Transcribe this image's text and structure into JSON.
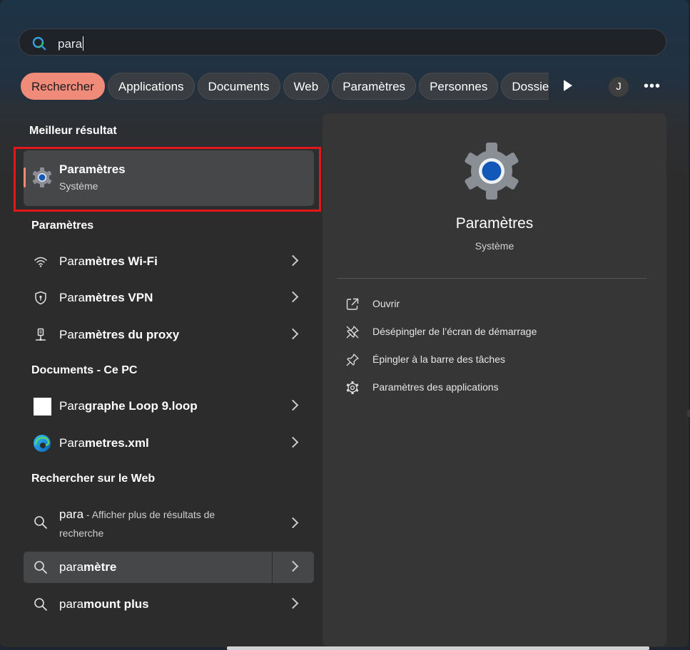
{
  "search": {
    "query": "para"
  },
  "chips": [
    "Rechercher",
    "Applications",
    "Documents",
    "Web",
    "Paramètres",
    "Personnes",
    "Dossie"
  ],
  "avatar": {
    "initial": "J"
  },
  "sections": {
    "best": "Meilleur résultat",
    "settings": "Paramètres",
    "documents": "Documents - Ce PC",
    "web": "Rechercher sur le Web"
  },
  "best_result": {
    "title": "Paramètres",
    "subtitle": "Système"
  },
  "settings_items": [
    {
      "prefix": "Para",
      "rest": "mètres Wi-Fi",
      "icon": "wifi-icon"
    },
    {
      "prefix": "Para",
      "rest": "mètres VPN",
      "icon": "shield-icon"
    },
    {
      "prefix": "Para",
      "rest": "mètres du proxy",
      "icon": "proxy-icon"
    }
  ],
  "document_items": [
    {
      "prefix": "Para",
      "rest": "graphe Loop 9.loop",
      "icon": "loop-file-icon"
    },
    {
      "prefix": "Para",
      "rest": "metres.xml",
      "icon": "edge-icon"
    }
  ],
  "web_items": [
    {
      "query": "para",
      "separator": " - ",
      "desc": "Afficher plus de résultats de recherche"
    },
    {
      "prefix": "para",
      "rest": "mètre"
    },
    {
      "prefix": "para",
      "rest": "mount plus"
    }
  ],
  "detail": {
    "title": "Paramètres",
    "subtitle": "Système",
    "actions": [
      {
        "label": "Ouvrir",
        "icon": "open-external-icon"
      },
      {
        "label": "Désépingler de l’écran de démarrage",
        "icon": "unpin-icon"
      },
      {
        "label": "Épingler à la barre des tâches",
        "icon": "pin-icon"
      },
      {
        "label": "Paramètres des applications",
        "icon": "gear-icon"
      }
    ]
  },
  "colors": {
    "accent": "#ef8b78",
    "highlight": "#e3161b"
  }
}
